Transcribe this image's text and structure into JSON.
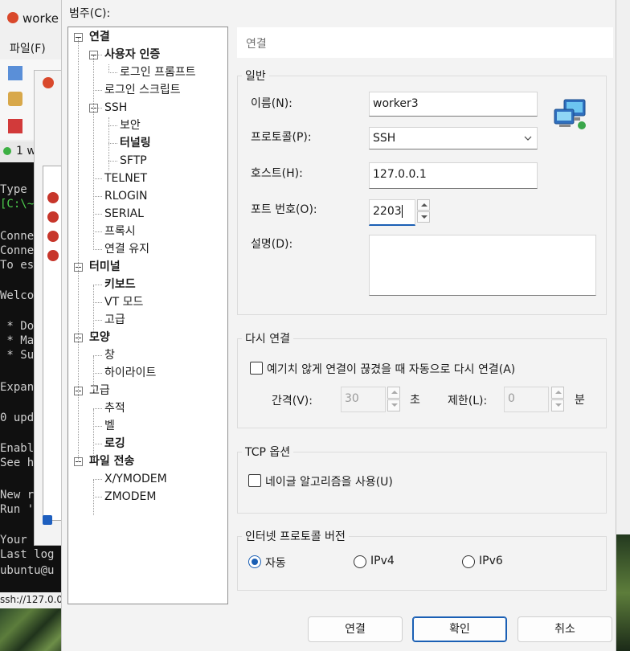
{
  "background_app": {
    "title": "worke",
    "menu_file": "파일(F)",
    "tab_label": "1 w",
    "terminal_lines": [
      "Type",
      "[C:\\~",
      "",
      "Conne",
      "Conne",
      "To es",
      "",
      "Welco",
      "",
      " * Do",
      " * Ma",
      " * Su",
      "",
      "Expan",
      "",
      "0 upd",
      "",
      "Enabl",
      "See h",
      "",
      "New r",
      "Run '",
      "",
      "Your ",
      "Last log",
      "ubuntu@u"
    ],
    "status": "ssh://127.0.0"
  },
  "dialog": {
    "category_label": "범주(C):",
    "tree": [
      {
        "label": "연결",
        "bold": true,
        "level": 0,
        "expander": true
      },
      {
        "label": "사용자 인증",
        "bold": true,
        "level": 1,
        "expander": true
      },
      {
        "label": "로그인 프롬프트",
        "bold": false,
        "level": 2
      },
      {
        "label": "로그인 스크립트",
        "bold": false,
        "level": 1
      },
      {
        "label": "SSH",
        "bold": false,
        "level": 1,
        "expander": true
      },
      {
        "label": "보안",
        "bold": false,
        "level": 2
      },
      {
        "label": "터널링",
        "bold": true,
        "level": 2
      },
      {
        "label": "SFTP",
        "bold": false,
        "level": 2
      },
      {
        "label": "TELNET",
        "bold": false,
        "level": 1
      },
      {
        "label": "RLOGIN",
        "bold": false,
        "level": 1
      },
      {
        "label": "SERIAL",
        "bold": false,
        "level": 1
      },
      {
        "label": "프록시",
        "bold": false,
        "level": 1
      },
      {
        "label": "연결 유지",
        "bold": false,
        "level": 1
      },
      {
        "label": "터미널",
        "bold": true,
        "level": 0,
        "expander": true
      },
      {
        "label": "키보드",
        "bold": true,
        "level": 1
      },
      {
        "label": "VT 모드",
        "bold": false,
        "level": 1
      },
      {
        "label": "고급",
        "bold": false,
        "level": 1
      },
      {
        "label": "모양",
        "bold": true,
        "level": 0,
        "expander": true
      },
      {
        "label": "창",
        "bold": false,
        "level": 1
      },
      {
        "label": "하이라이트",
        "bold": false,
        "level": 1
      },
      {
        "label": "고급",
        "bold": false,
        "level": 0,
        "expander": true
      },
      {
        "label": "추적",
        "bold": false,
        "level": 1
      },
      {
        "label": "벨",
        "bold": false,
        "level": 1
      },
      {
        "label": "로깅",
        "bold": true,
        "level": 1
      },
      {
        "label": "파일 전송",
        "bold": true,
        "level": 0,
        "expander": true
      },
      {
        "label": "X/YMODEM",
        "bold": false,
        "level": 1
      },
      {
        "label": "ZMODEM",
        "bold": false,
        "level": 1
      }
    ],
    "panel_title": "연결",
    "general": {
      "group_label": "일반",
      "name_label": "이름(N):",
      "name_value": "worker3",
      "protocol_label": "프로토콜(P):",
      "protocol_value": "SSH",
      "host_label": "호스트(H):",
      "host_value": "127.0.0.1",
      "port_label": "포트 번호(O):",
      "port_value": "2203",
      "desc_label": "설명(D):",
      "desc_value": ""
    },
    "reconnect": {
      "group_label": "다시 연결",
      "auto_label": "예기치 않게 연결이 끊겼을 때 자동으로 다시 연결(A)",
      "auto_checked": false,
      "interval_label": "간격(V):",
      "interval_value": "30",
      "interval_unit": "초",
      "limit_label": "제한(L):",
      "limit_value": "0",
      "limit_unit": "분"
    },
    "tcp": {
      "group_label": "TCP 옵션",
      "nagle_label": "네이글 알고리즘을 사용(U)",
      "nagle_checked": false
    },
    "ip_version": {
      "group_label": "인터넷 프로토콜 버전",
      "options": [
        "자동",
        "IPv4",
        "IPv6"
      ],
      "selected": "자동"
    },
    "buttons": {
      "connect": "연결",
      "ok": "확인",
      "cancel": "취소"
    },
    "colors": {
      "accent": "#1a5fb4"
    }
  }
}
